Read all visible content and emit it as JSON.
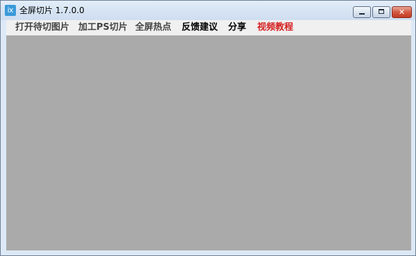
{
  "window": {
    "title": "全屏切片 1.7.0.0",
    "icon_text": "ⅸ",
    "close_glyph": "✕"
  },
  "menu": {
    "items": [
      {
        "label": "打开待切图片",
        "color": "#444444"
      },
      {
        "label": "加工PS切片",
        "color": "#444444"
      },
      {
        "label": "全屏热点",
        "color": "#444444"
      },
      {
        "label": "反馈建议",
        "color": "#000000"
      },
      {
        "label": "分享",
        "color": "#000000"
      },
      {
        "label": "视频教程",
        "color": "#d42020"
      }
    ]
  },
  "colors": {
    "workarea_background": "#aaaaaa",
    "accent_link": "#d42020"
  }
}
